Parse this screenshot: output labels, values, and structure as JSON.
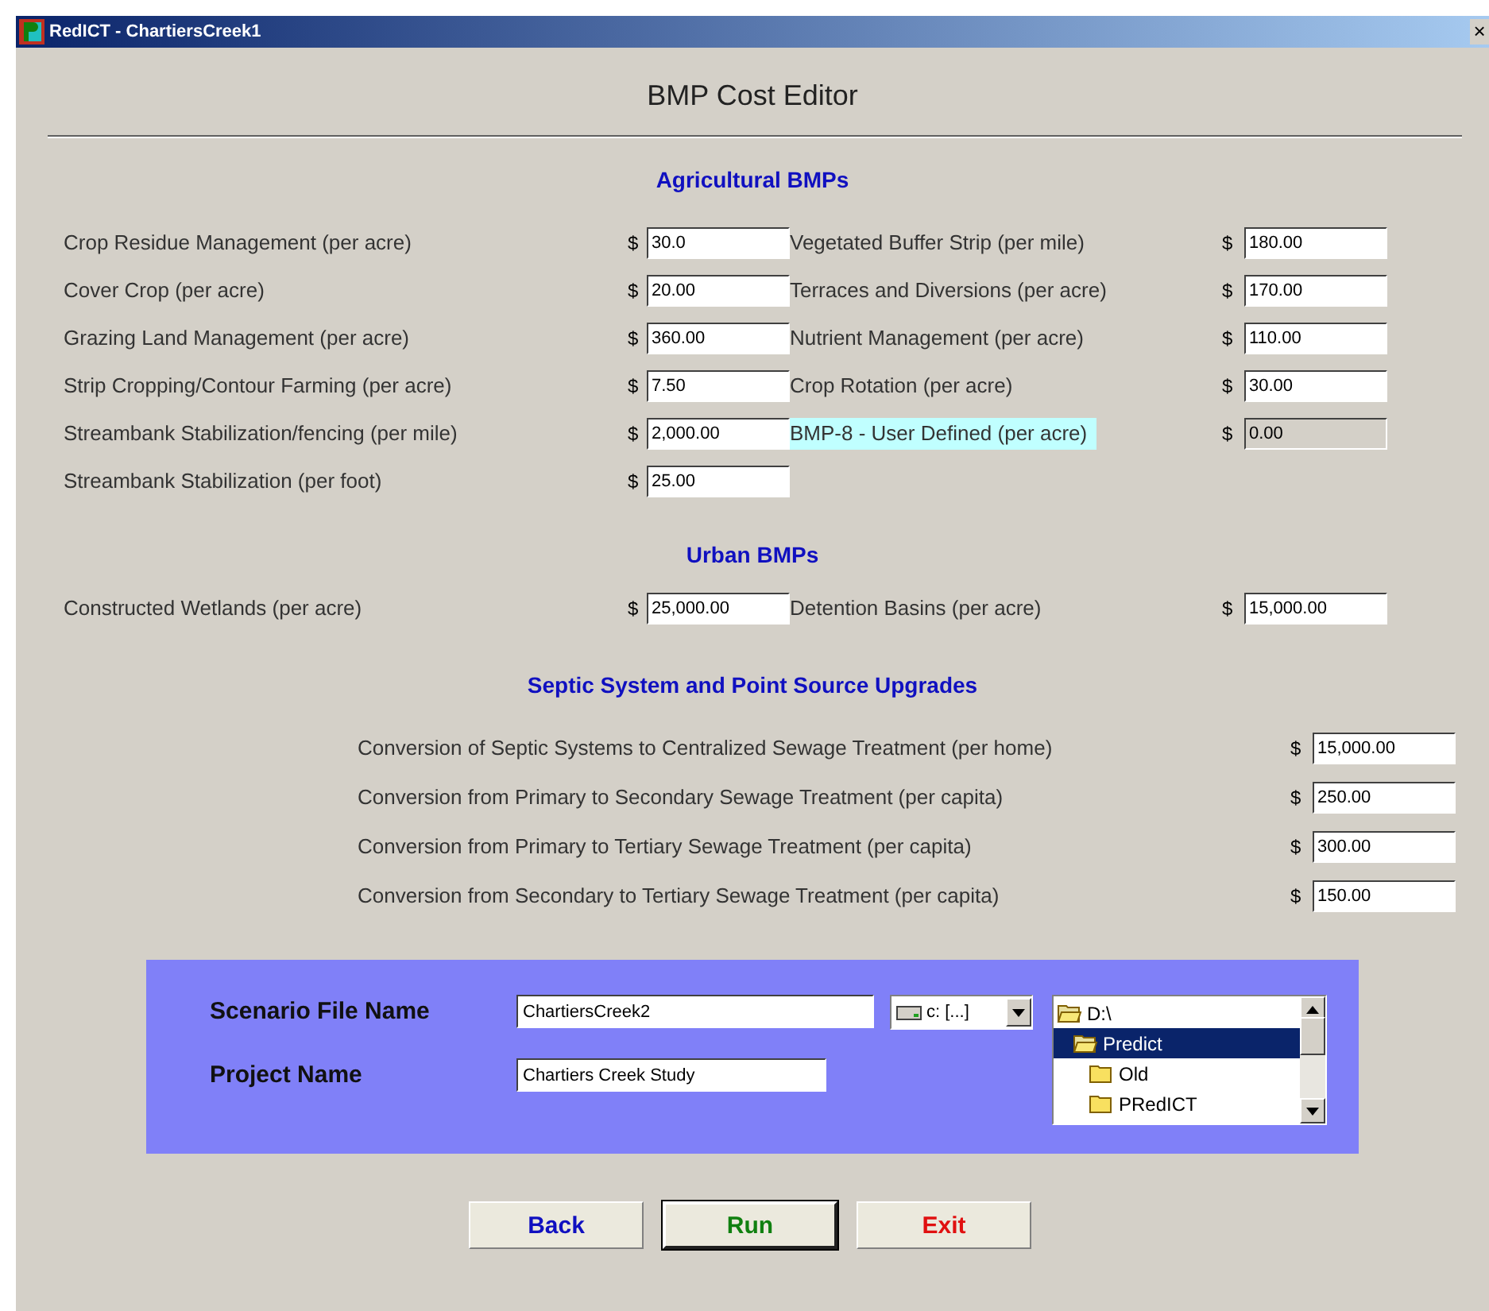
{
  "window": {
    "title": "RedICT - ChartiersCreek1",
    "close": "×"
  },
  "heading": "BMP Cost Editor",
  "agricultural": {
    "title": "Agricultural BMPs",
    "left": [
      {
        "label": "Crop Residue Management (per acre)",
        "currency": "$",
        "value": "30.0",
        "highlighted": false,
        "disabled": false
      },
      {
        "label": "Cover Crop (per acre)",
        "currency": "$",
        "value": "20.00",
        "highlighted": false,
        "disabled": false
      },
      {
        "label": "Grazing Land Management (per acre)",
        "currency": "$",
        "value": "360.00",
        "highlighted": false,
        "disabled": false
      },
      {
        "label": "Strip Cropping/Contour Farming (per acre)",
        "currency": "$",
        "value": "7.50",
        "highlighted": false,
        "disabled": false
      },
      {
        "label": "Streambank Stabilization/fencing (per mile)",
        "currency": "$",
        "value": "2,000.00",
        "highlighted": false,
        "disabled": false
      },
      {
        "label": "Streambank Stabilization (per foot)",
        "currency": "$",
        "value": "25.00",
        "highlighted": false,
        "disabled": false
      }
    ],
    "right": [
      {
        "label": "Vegetated Buffer Strip (per mile)",
        "currency": "$",
        "value": "180.00",
        "highlighted": false,
        "disabled": false
      },
      {
        "label": "Terraces and Diversions (per acre)",
        "currency": "$",
        "value": "170.00",
        "highlighted": false,
        "disabled": false
      },
      {
        "label": "Nutrient Management (per acre)",
        "currency": "$",
        "value": "110.00",
        "highlighted": false,
        "disabled": false
      },
      {
        "label": "Crop Rotation (per acre)",
        "currency": "$",
        "value": "30.00",
        "highlighted": false,
        "disabled": false
      },
      {
        "label": "BMP-8 - User Defined (per acre)",
        "currency": "$",
        "value": "0.00",
        "highlighted": true,
        "disabled": true
      }
    ]
  },
  "urban": {
    "title": "Urban BMPs",
    "items": [
      {
        "label": "Constructed Wetlands (per acre)",
        "currency": "$",
        "value": "25,000.00",
        "highlighted": false,
        "disabled": false
      },
      {
        "label": "Detention Basins (per acre)",
        "currency": "$",
        "value": "15,000.00",
        "highlighted": false,
        "disabled": false
      }
    ]
  },
  "septic": {
    "title": "Septic System and Point Source Upgrades",
    "items": [
      {
        "label": "Conversion of Septic Systems to Centralized Sewage Treatment (per home)",
        "currency": "$",
        "value": "15,000.00",
        "highlighted": false,
        "disabled": false
      },
      {
        "label": "Conversion from Primary to Secondary Sewage Treatment (per capita)",
        "currency": "$",
        "value": "250.00",
        "highlighted": false,
        "disabled": false
      },
      {
        "label": "Conversion from Primary to Tertiary Sewage Treatment (per capita)",
        "currency": "$",
        "value": "300.00",
        "highlighted": false,
        "disabled": false
      },
      {
        "label": "Conversion from Secondary to Tertiary Sewage Treatment (per capita)",
        "currency": "$",
        "value": "150.00",
        "highlighted": false,
        "disabled": false
      }
    ]
  },
  "scenario": {
    "file_label": "Scenario File Name",
    "file_value": "ChartiersCreek2",
    "project_label": "Project Name",
    "project_value": "Chartiers Creek Study",
    "drive": "c: [...]",
    "folders": [
      {
        "name": "D:\\",
        "open": true,
        "selected": false,
        "children": [
          {
            "name": "Predict",
            "open": true,
            "selected": true,
            "children": [
              {
                "name": "Old",
                "open": false,
                "selected": false
              },
              {
                "name": "PRedICT",
                "open": false,
                "selected": false
              }
            ]
          }
        ]
      }
    ]
  },
  "buttons": [
    {
      "label": "Back",
      "kind": "back",
      "default": false
    },
    {
      "label": "Run",
      "kind": "run",
      "default": true
    },
    {
      "label": "Exit",
      "kind": "exit",
      "default": false
    }
  ]
}
